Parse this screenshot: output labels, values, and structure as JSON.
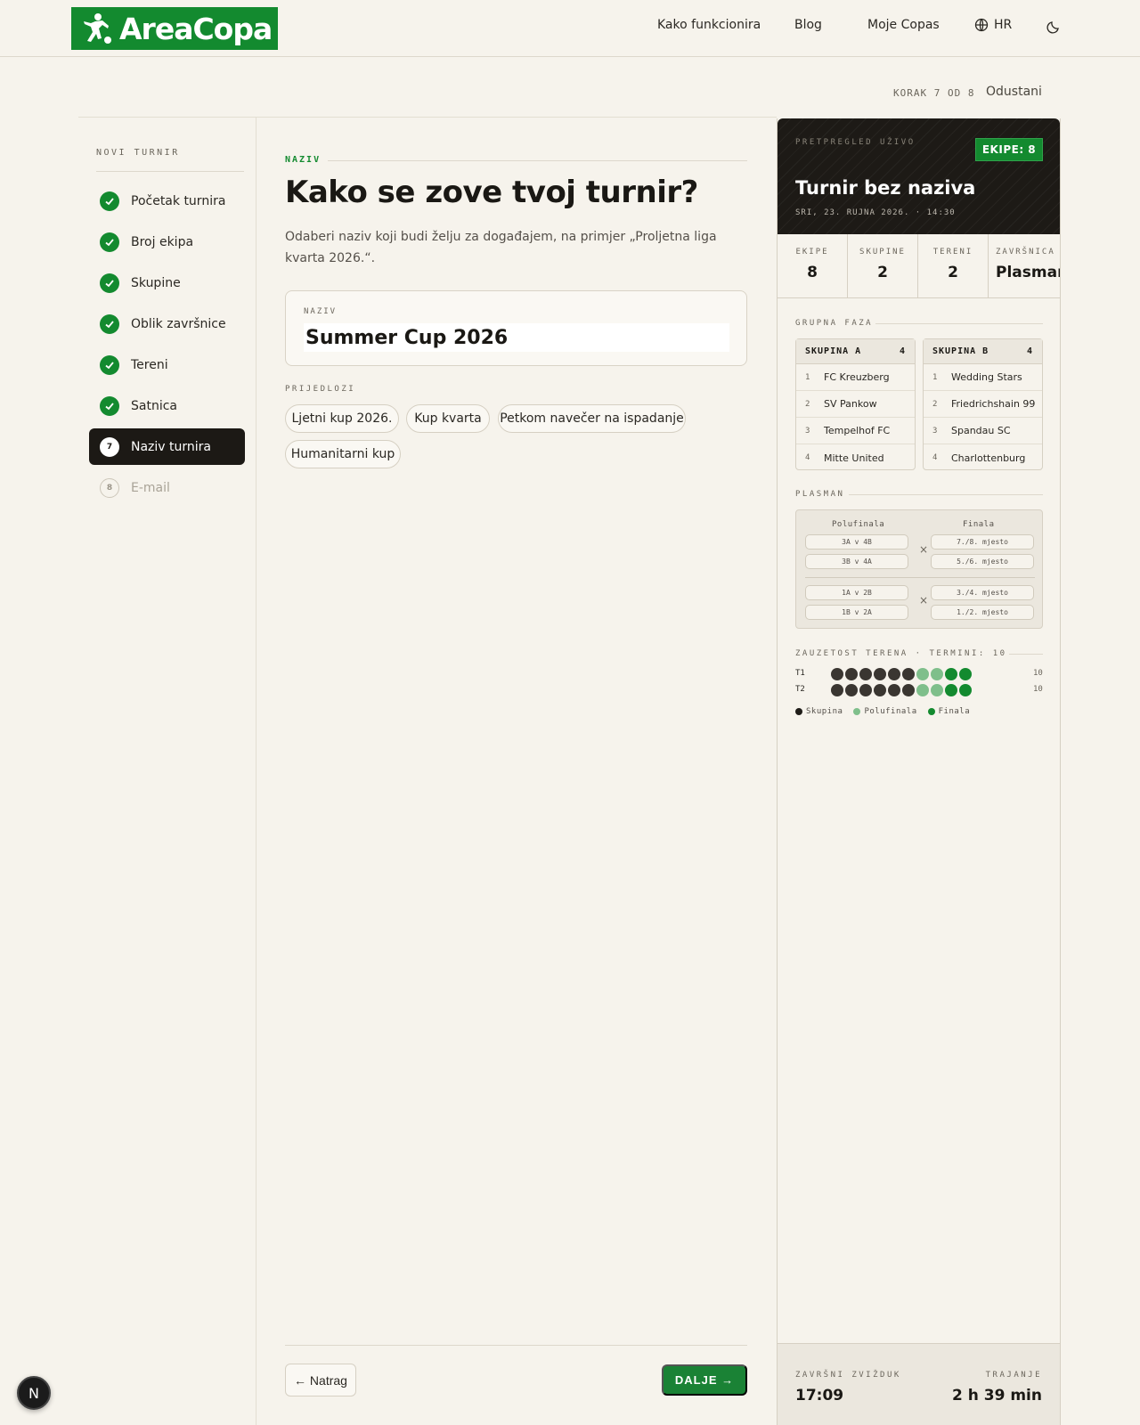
{
  "header": {
    "logo_text": "AreaCopa",
    "nav": [
      {
        "label": "Kako funkcionira"
      },
      {
        "label": "Blog"
      },
      {
        "label": "Moje Copas"
      }
    ],
    "lang": "HR"
  },
  "stepbar": {
    "counter": "KORAK 7 OD 8",
    "cancel": "Odustani"
  },
  "sidebar": {
    "title": "NOVI TURNIR",
    "steps": [
      {
        "label": "Početak turnira",
        "state": "done"
      },
      {
        "label": "Broj ekipa",
        "state": "done"
      },
      {
        "label": "Skupine",
        "state": "done"
      },
      {
        "label": "Oblik završnice",
        "state": "done"
      },
      {
        "label": "Tereni",
        "state": "done"
      },
      {
        "label": "Satnica",
        "state": "done"
      },
      {
        "label": "Naziv turnira",
        "num": "7",
        "state": "active"
      },
      {
        "label": "E-mail",
        "num": "8",
        "state": "future"
      }
    ]
  },
  "main": {
    "eyebrow": "NAZIV",
    "title": "Kako se zove tvoj turnir?",
    "description": "Odaberi naziv koji budi želju za događajem, na primjer „Proljetna liga kvarta 2026.“.",
    "name_label": "NAZIV",
    "name_value": "Summer Cup 2026",
    "suggestions_title": "PRIJEDLOZI",
    "suggestions": [
      "Ljetni kup 2026.",
      "Kup kvarta",
      "Petkom navečer na ispadanje",
      "Humanitarni kup"
    ],
    "back_label": "← Natrag",
    "next_label": "DALJE →"
  },
  "preview": {
    "eyebrow": "PRETPREGLED UŽIVO",
    "badge": "EKIPE: 8",
    "title": "Turnir bez naziva",
    "date": "SRI, 23. RUJNA 2026. · 14:30",
    "stats": [
      {
        "label": "EKIPE",
        "value": "8"
      },
      {
        "label": "SKUPINE",
        "value": "2"
      },
      {
        "label": "TERENI",
        "value": "2"
      },
      {
        "label": "ZAVRŠNICA",
        "value": "Plasman"
      }
    ],
    "group_title": "GRUPNA FAZA",
    "groups": [
      {
        "name": "SKUPINA A",
        "count": "4",
        "teams": [
          {
            "n": "1",
            "name": "FC Kreuzberg"
          },
          {
            "n": "2",
            "name": "SV Pankow"
          },
          {
            "n": "3",
            "name": "Tempelhof FC"
          },
          {
            "n": "4",
            "name": "Mitte United"
          }
        ]
      },
      {
        "name": "SKUPINA B",
        "count": "4",
        "teams": [
          {
            "n": "1",
            "name": "Wedding Stars"
          },
          {
            "n": "2",
            "name": "Friedrichshain 99"
          },
          {
            "n": "3",
            "name": "Spandau SC"
          },
          {
            "n": "4",
            "name": "Charlottenburg"
          }
        ]
      }
    ],
    "placement_title": "PLASMAN",
    "bracket": {
      "semi_label": "Polufinala",
      "final_label": "Finala",
      "semis": [
        "3A v 4B",
        "3B v 4A",
        "1A v 2B",
        "1B v 2A"
      ],
      "finals": [
        "7./8. mjesto",
        "5./6. mjesto",
        "3./4. mjesto",
        "1./2. mjesto"
      ],
      "x": "×"
    },
    "courts_title": "ZAUZETOST TERENA · TERMINI: 10",
    "courts": [
      {
        "label": "T1",
        "count": "10",
        "slots": [
          "g",
          "g",
          "g",
          "g",
          "g",
          "g",
          "s",
          "s",
          "f",
          "f"
        ]
      },
      {
        "label": "T2",
        "count": "10",
        "slots": [
          "g",
          "g",
          "g",
          "g",
          "g",
          "g",
          "s",
          "s",
          "f",
          "f"
        ]
      }
    ],
    "legend": [
      {
        "label": "Skupina",
        "color": "#1f1c18"
      },
      {
        "label": "Polufinala",
        "color": "#7fbf8b"
      },
      {
        "label": "Finala",
        "color": "#138a2f"
      }
    ],
    "slot_colors": {
      "g": "#3a3631",
      "s": "#7fbf8b",
      "f": "#138a2f"
    },
    "foot_left_label": "ZAVRŠNI ZVIŽDUK",
    "foot_left_value": "17:09",
    "foot_right_label": "TRAJANJE",
    "foot_right_value": "2 h 39 min"
  },
  "dev_badge": "N"
}
